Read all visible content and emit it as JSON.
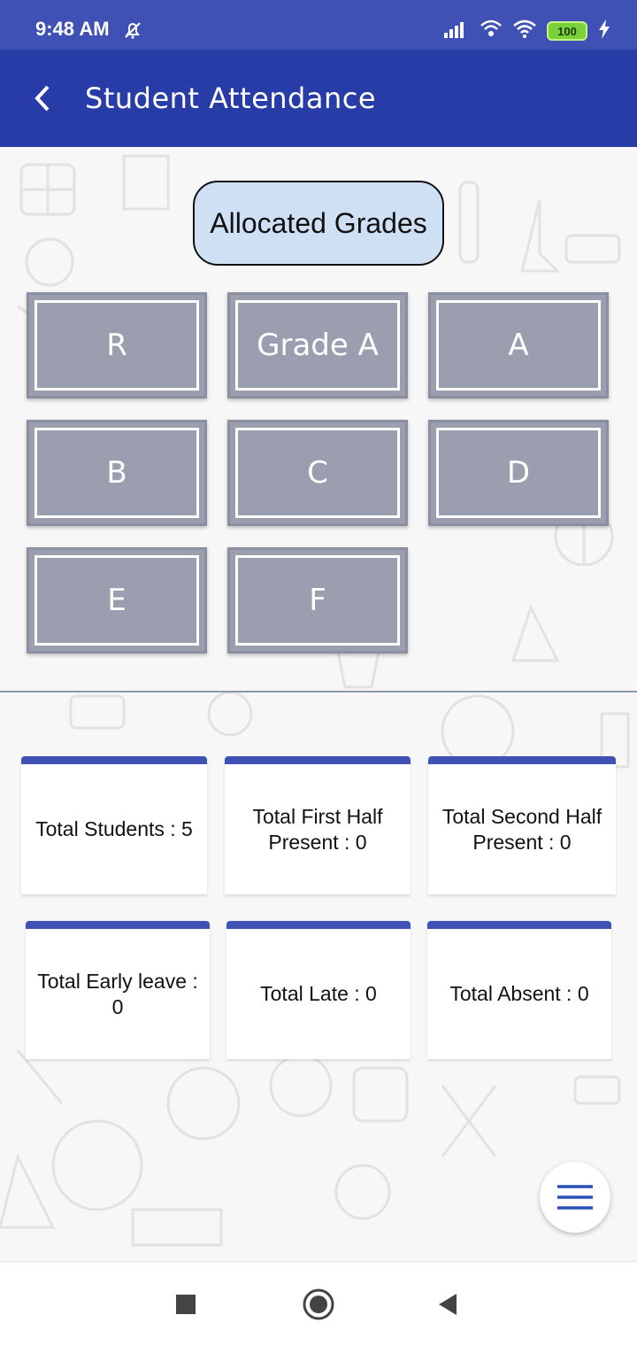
{
  "status_bar": {
    "time": "9:48 AM",
    "icons": [
      "muted-bell-icon",
      "signal-icon",
      "wifi-calling-icon",
      "wifi-icon",
      "battery-icon",
      "charging-icon"
    ],
    "battery": "100"
  },
  "app_bar": {
    "title": "Student Attendance",
    "back_icon": "chevron-left-icon"
  },
  "allocated_grades_label": "Allocated Grades",
  "grades": [
    "R",
    "Grade A",
    "A",
    "B",
    "C",
    "D",
    "E",
    "F"
  ],
  "stats": {
    "total_students": "Total Students : 5",
    "total_first_half": "Total First Half Present : 0",
    "total_second_half": "Total Second Half Present : 0",
    "total_early_leave": "Total Early leave : 0",
    "total_late": "Total Late : 0",
    "total_absent": "Total Absent : 0"
  },
  "fab_icon": "menu-icon",
  "nav_bar": {
    "icons": [
      "recents-square-icon",
      "home-circle-icon",
      "back-triangle-icon"
    ]
  },
  "colors": {
    "status_bar": "#3f51b5",
    "app_bar": "#283ca8",
    "accent": "#3f51b5",
    "tile": "#9a9eaf",
    "allocated_bg": "#cfe0f4"
  }
}
